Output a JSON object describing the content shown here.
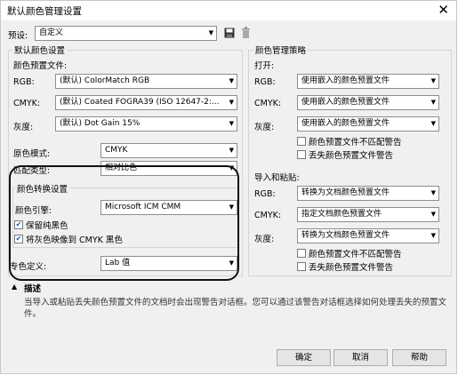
{
  "window": {
    "title": "默认颜色管理设置"
  },
  "preset": {
    "label": "预设:",
    "value": "自定义"
  },
  "default_settings": {
    "group_title": "默认颜色设置",
    "profiles_label": "颜色预置文件:",
    "rgb": {
      "label": "RGB:",
      "prefix": "(默认)",
      "value": "ColorMatch RGB"
    },
    "cmyk": {
      "label": "CMYK:",
      "prefix": "(默认)",
      "value": "Coated FOGRA39 (ISO 12647-2:..."
    },
    "gray": {
      "label": "灰度:",
      "prefix": "(默认)",
      "value": "Dot Gain 15%"
    },
    "primary_mode": {
      "label": "原色模式:",
      "value": "CMYK"
    },
    "match_type": {
      "label": "匹配类型:",
      "value": "相对比色"
    }
  },
  "conversion": {
    "group_title": "颜色转换设置",
    "engine": {
      "label": "颜色引擎:",
      "value": "Microsoft ICM CMM"
    },
    "preserve_black": {
      "label": "保留纯黑色",
      "checked": true
    },
    "map_gray": {
      "label": "将灰色映像到 CMYK 黑色",
      "checked": true
    },
    "spot_definition": {
      "label": "专色定义:",
      "value": "Lab 值"
    }
  },
  "policy": {
    "group_title": "颜色管理策略",
    "open": {
      "label": "打开:",
      "rgb": {
        "label": "RGB:",
        "value": "使用嵌入的颜色预置文件"
      },
      "cmyk": {
        "label": "CMYK:",
        "value": "使用嵌入的颜色预置文件"
      },
      "gray": {
        "label": "灰度:",
        "value": "使用嵌入的颜色预置文件"
      },
      "warn_mismatch": {
        "label": "颜色预置文件不匹配警告",
        "checked": false
      },
      "warn_missing": {
        "label": "丢失颜色预置文件警告",
        "checked": false
      }
    },
    "import": {
      "label": "导入和粘贴:",
      "rgb": {
        "label": "RGB:",
        "value": "转换为文档颜色预置文件"
      },
      "cmyk": {
        "label": "CMYK:",
        "value": "指定文档颜色预置文件"
      },
      "gray": {
        "label": "灰度:",
        "value": "转换为文档颜色预置文件"
      },
      "warn_mismatch": {
        "label": "颜色预置文件不匹配警告",
        "checked": false
      },
      "warn_missing": {
        "label": "丢失颜色预置文件警告",
        "checked": false
      }
    }
  },
  "description": {
    "title": "描述",
    "text": "当导入或粘贴丢失颜色预置文件的文档时会出现警告对话框。您可以通过该警告对话框选择如何处理丢失的预置文件。"
  },
  "buttons": {
    "ok": "确定",
    "cancel": "取消",
    "help": "帮助"
  }
}
